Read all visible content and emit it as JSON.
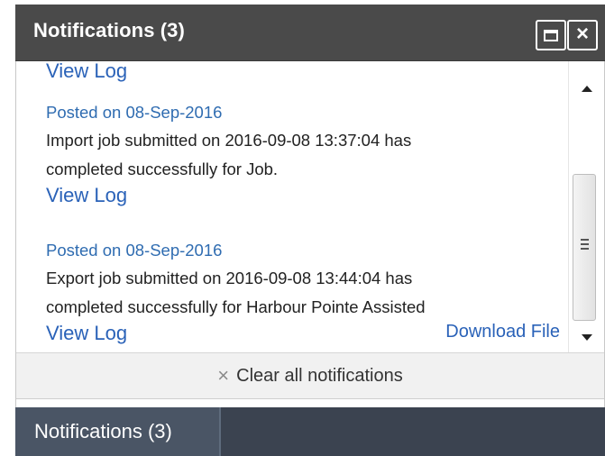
{
  "window": {
    "title": "Notifications (3)",
    "maximize_icon": "maximize-icon",
    "close_icon": "close-icon",
    "close_glyph": "×"
  },
  "notifications": {
    "top_view_log": "View Log",
    "items": [
      {
        "posted": "Posted on 08-Sep-2016",
        "message": "Import job submitted on 2016-09-08 13:37:04 has completed successfully for Job.",
        "message_lines": [
          "Import job submitted on 2016-09-08 13:37:04 has",
          "completed successfully for Job."
        ],
        "view_log": "View Log"
      },
      {
        "posted": "Posted on 08-Sep-2016",
        "message": "Export job submitted on 2016-09-08 13:44:04 has completed successfully for Harbour Pointe Assisted",
        "message_lines": [
          "Export job submitted on 2016-09-08 13:44:04 has",
          "completed successfully for Harbour Pointe Assisted"
        ],
        "view_log": "View Log",
        "download": "Download File"
      }
    ]
  },
  "footer": {
    "clear_icon": "×",
    "clear_label": "Clear all notifications"
  },
  "taskbar": {
    "tab_label": "Notifications (3)"
  },
  "colors": {
    "titlebar": "#4a4a4a",
    "link": "#2a62b8",
    "footer_bg": "#f1f1f1",
    "taskbar": "#3b4350"
  }
}
